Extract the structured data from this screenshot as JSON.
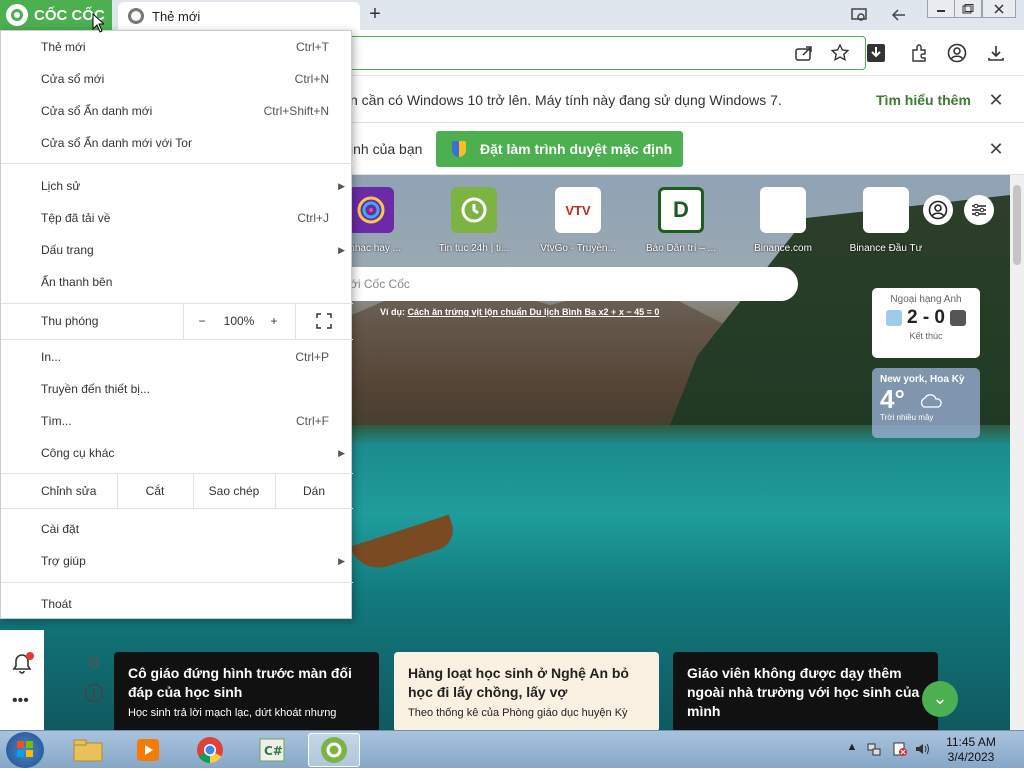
{
  "browser": {
    "brand": "CỐC CỐC",
    "tab_title": "Thẻ mới",
    "new_tab_symbol": "+"
  },
  "infobar1": {
    "text": "n cần có Windows 10 trở lên. Máy tính này đang sử dụng Windows 7.",
    "link": "Tìm hiểu thêm"
  },
  "infobar2": {
    "text": "ịnh của bạn",
    "button": "Đặt làm trình duyệt mặc định"
  },
  "menu": {
    "new_tab": "Thẻ mới",
    "new_tab_sc": "Ctrl+T",
    "new_window": "Cửa sổ mới",
    "new_window_sc": "Ctrl+N",
    "incognito": "Cửa sổ Ẩn danh mới",
    "incognito_sc": "Ctrl+Shift+N",
    "incognito_tor": "Cửa sổ Ẩn danh mới với Tor",
    "history": "Lịch sử",
    "downloads": "Tệp đã tải về",
    "downloads_sc": "Ctrl+J",
    "bookmarks": "Dấu trang",
    "hide_sidebar": "Ẩn thanh bên",
    "zoom": "Thu phóng",
    "zoom_minus": "−",
    "zoom_value": "100%",
    "zoom_plus": "+",
    "print": "In...",
    "print_sc": "Ctrl+P",
    "cast": "Truyền đến thiết bị...",
    "find": "Tìm...",
    "find_sc": "Ctrl+F",
    "more_tools": "Công cụ khác",
    "edit": "Chỉnh sửa",
    "cut": "Cắt",
    "copy": "Sao chép",
    "paste": "Dán",
    "settings": "Cài đặt",
    "help": "Trợ giúp",
    "exit": "Thoát"
  },
  "shortcuts": [
    {
      "label": "e nhạc hay ...",
      "icon": "music-icon"
    },
    {
      "label": "Tin tuc 24h | ti...",
      "icon": "clock-icon"
    },
    {
      "label": "VtvGo - Truyền...",
      "tile": "VTV"
    },
    {
      "label": "Báo Dân trí – ...",
      "tile": "D"
    },
    {
      "label": "Binance.com",
      "icon": "broken-image-icon"
    },
    {
      "label": "Binance Đầu Tư",
      "icon": "broken-image-icon"
    }
  ],
  "search": {
    "placeholder": "ới Cốc Cốc",
    "hint_prefix": "Ví dụ:",
    "hint_link": "Cách ăn trứng vịt lộn chuẩn Du lịch Bình Ba x2 + x − 45 = 0"
  },
  "score": {
    "league": "Ngoại hạng Anh",
    "result": "2 - 0",
    "status": "Kết thúc"
  },
  "weather": {
    "city": "New york, Hoa Kỳ",
    "temp": "4°",
    "desc": "Trời nhiều mây"
  },
  "news": [
    {
      "title": "Cô giáo đứng hình trước màn đối đáp của học sinh",
      "snippet": "Học sinh trả lời mạch lạc, dứt khoát nhưng"
    },
    {
      "title": "Hàng loạt học sinh ở Nghệ An bỏ học đi lấy chồng, lấy vợ",
      "snippet": "Theo thống kê của Phòng giáo dục huyện Kỳ"
    },
    {
      "title": "Giáo viên không được dạy thêm ngoài nhà trường với học sinh của mình",
      "snippet": ""
    }
  ],
  "taskbar": {
    "time": "11:45 AM",
    "date": "3/4/2023"
  },
  "colors": {
    "accent": "#4caf50",
    "link": "#3a7d31"
  }
}
